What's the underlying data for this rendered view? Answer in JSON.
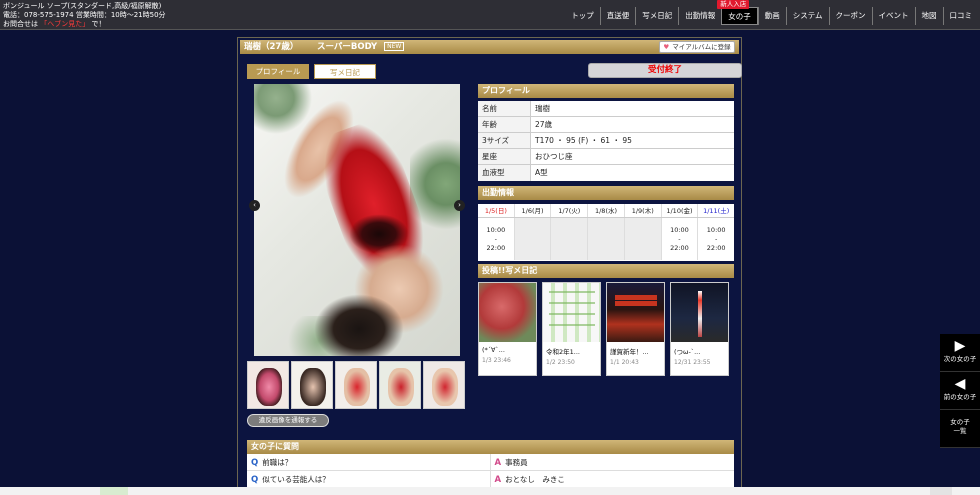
{
  "header": {
    "shop_name": "ボンジュール ソープ(スタンダード,高級/福原解散)",
    "tel_line": "電話：078-575-1974 営業時間：10時〜21時50分",
    "contact_prefix": "お問合せは",
    "contact_highlight": "「ヘブン見た」",
    "contact_suffix": "で！",
    "nav": [
      {
        "label": "トップ"
      },
      {
        "label": "直送便"
      },
      {
        "label": "写メ日記"
      },
      {
        "label": "出勤情報"
      },
      {
        "label": "女の子",
        "badge": "新人入店"
      },
      {
        "label": "動画"
      },
      {
        "label": "システム"
      },
      {
        "label": "クーポン"
      },
      {
        "label": "イベント"
      },
      {
        "label": "地図"
      },
      {
        "label": "口コミ"
      }
    ]
  },
  "girl": {
    "name": "瑞樹（27歳）",
    "catch": "スーパーBODY",
    "new_icon": "NEW",
    "album_button": "マイアルバムに登録",
    "tab_profile": "プロフィール",
    "tab_diary": "写メ日記",
    "closed_label": "受付終了",
    "report_button": "違反画像を通報する"
  },
  "profile": {
    "heading": "プロフィール",
    "rows": [
      {
        "k": "名前",
        "v": "瑞樹"
      },
      {
        "k": "年齢",
        "v": "27歳"
      },
      {
        "k": "3サイズ",
        "v": "T170 ・ 95 (F) ・ 61 ・ 95"
      },
      {
        "k": "星座",
        "v": "おひつじ座"
      },
      {
        "k": "血液型",
        "v": "A型"
      }
    ]
  },
  "schedule": {
    "heading": "出勤情報",
    "days": [
      "1/5(日)",
      "1/6(月)",
      "1/7(火)",
      "1/8(水)",
      "1/9(木)",
      "1/10(金)",
      "1/11(土)"
    ],
    "shifts": [
      {
        "start": "10:00",
        "sep": "-",
        "end": "22:00"
      },
      {
        "start": "",
        "sep": "",
        "end": ""
      },
      {
        "start": "",
        "sep": "",
        "end": ""
      },
      {
        "start": "",
        "sep": "",
        "end": ""
      },
      {
        "start": "",
        "sep": "",
        "end": ""
      },
      {
        "start": "10:00",
        "sep": "-",
        "end": "22:00"
      },
      {
        "start": "10:00",
        "sep": "-",
        "end": "22:00"
      }
    ]
  },
  "diary": {
    "heading": "投稿!!写メ日記",
    "posts": [
      {
        "title": "(*´∀`...",
        "date": "1/3 23:46"
      },
      {
        "title": "令和2年1...",
        "date": "1/2 23:50"
      },
      {
        "title": "謹賀新年！...",
        "date": "1/1 20:43"
      },
      {
        "title": "(つω-`...",
        "date": "12/31 23:55"
      }
    ]
  },
  "qa": {
    "heading": "女の子に質問",
    "q_label": "Q",
    "a_label": "A",
    "items": [
      {
        "q": "前職は？",
        "a": "事務員"
      },
      {
        "q": "似ている芸能人は？",
        "a": "おとなし　みきこ"
      }
    ]
  },
  "sidenav": {
    "next": "次の女の子",
    "prev": "前の女の子",
    "list_line1": "女の子",
    "list_line2": "一覧"
  },
  "arrows": {
    "left": "‹",
    "right": "›",
    "next_glyph": "▶",
    "prev_glyph": "◀"
  },
  "colors": {
    "accent_gold": "#b99a52",
    "closed_red": "#ee0000",
    "page_bg": "#0b1136"
  }
}
